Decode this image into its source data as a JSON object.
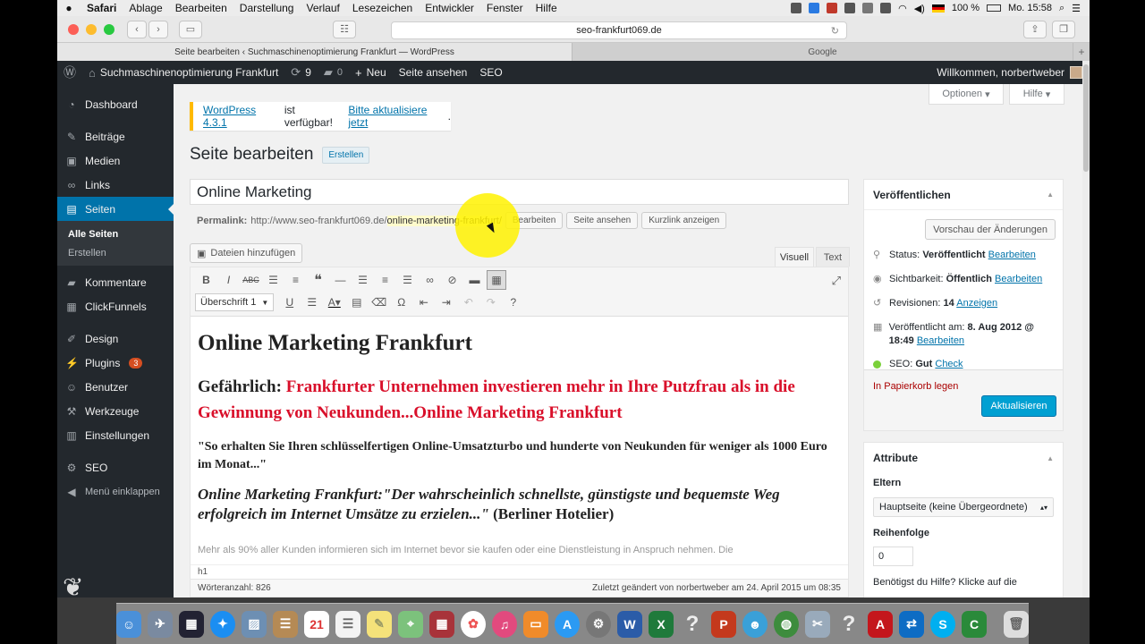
{
  "menubar": {
    "app": "Safari",
    "items": [
      "Ablage",
      "Bearbeiten",
      "Darstellung",
      "Verlauf",
      "Lesezeichen",
      "Entwickler",
      "Fenster",
      "Hilfe"
    ],
    "battery": "100 %",
    "clock": "Mo. 15:58"
  },
  "browser": {
    "url": "seo-frankfurt069.de",
    "tabs": [
      {
        "label": "Seite bearbeiten ‹ Suchmaschinenoptimierung Frankfurt — WordPress"
      },
      {
        "label": "Google"
      }
    ]
  },
  "adminbar": {
    "site": "Suchmaschinenoptimierung Frankfurt",
    "updates": "9",
    "comments": "0",
    "new": "Neu",
    "view": "Seite ansehen",
    "seo": "SEO",
    "welcome": "Willkommen, norbertweber"
  },
  "sidebar": {
    "items": [
      {
        "label": "Dashboard",
        "icon": "dashboard-icon"
      },
      {
        "label": "Beiträge",
        "icon": "pin-icon"
      },
      {
        "label": "Medien",
        "icon": "media-icon"
      },
      {
        "label": "Links",
        "icon": "link-icon"
      },
      {
        "label": "Seiten",
        "icon": "pages-icon"
      },
      {
        "label": "Kommentare",
        "icon": "comment-icon"
      },
      {
        "label": "ClickFunnels",
        "icon": "clickfunnels-icon"
      },
      {
        "label": "Design",
        "icon": "brush-icon"
      },
      {
        "label": "Plugins",
        "icon": "plugin-icon",
        "badge": "3"
      },
      {
        "label": "Benutzer",
        "icon": "users-icon"
      },
      {
        "label": "Werkzeuge",
        "icon": "wrench-icon"
      },
      {
        "label": "Einstellungen",
        "icon": "settings-icon"
      },
      {
        "label": "SEO",
        "icon": "seo-icon"
      },
      {
        "label": "Menü einklappen",
        "icon": "collapse-icon"
      }
    ],
    "sub": [
      "Alle Seiten",
      "Erstellen"
    ]
  },
  "screen_options": {
    "options": "Optionen",
    "help": "Hilfe"
  },
  "notice": {
    "link1": "WordPress 4.3.1",
    "text": "ist verfügbar!",
    "link2": "Bitte aktualisiere jetzt",
    "end": "."
  },
  "page": {
    "title": "Seite bearbeiten",
    "add_new": "Erstellen",
    "post_title": "Online Marketing",
    "permalink_label": "Permalink:",
    "permalink_base": "http://www.seo-frankfurt069.de/",
    "permalink_slug": "online-marketing-frankfurt/",
    "btn_edit": "Bearbeiten",
    "btn_view": "Seite ansehen",
    "btn_shortlink": "Kurzlink anzeigen",
    "media_btn": "Dateien hinzufügen",
    "tab_visual": "Visuell",
    "tab_text": "Text",
    "format_select": "Überschrift 1"
  },
  "content": {
    "h1": "Online Marketing Frankfurt",
    "h2_lead": "Gefährlich:",
    "h2_red": "Frankfurter Unternehmen investieren mehr in Ihre Putzfrau als in die Gewinnung von Neukunden...Online Marketing Frankfurt",
    "p1": "\"So erhalten Sie Ihren schlüsselfertigen Online-Umsatzturbo und hunderte von Neukunden für weniger als 1000 Euro im Monat...\"",
    "h3_italic": "Online Marketing Frankfurt:\"Der wahrscheinlich schnellste, günstigste und bequemste Weg erfolgreich im Internet Umsätze zu erzielen...\"",
    "h3_tail": "(Berliner Hotelier)",
    "fade_line": "Mehr als 90% aller Kunden informieren sich im Internet bevor sie kaufen oder eine Dienstleistung in Anspruch nehmen. Die",
    "path": "h1",
    "word_count": "Wörteranzahl: 826",
    "last_edit": "Zuletzt geändert von norbertweber am 24. April 2015 um 08:35"
  },
  "publish": {
    "title": "Veröffentlichen",
    "preview": "Vorschau der Änderungen",
    "status_label": "Status:",
    "status_value": "Veröffentlicht",
    "visibility_label": "Sichtbarkeit:",
    "visibility_value": "Öffentlich",
    "revisions_label": "Revisionen:",
    "revisions_value": "14",
    "revisions_link": "Anzeigen",
    "published_label": "Veröffentlicht am:",
    "published_value": "8. Aug 2012 @ 18:49",
    "edit": "Bearbeiten",
    "seo_label": "SEO:",
    "seo_value": "Gut",
    "seo_link": "Check",
    "trash": "In Papierkorb legen",
    "update": "Aktualisieren"
  },
  "attributes": {
    "title": "Attribute",
    "parent_label": "Eltern",
    "parent_value": "Hauptseite (keine Übergeordnete)",
    "order_label": "Reihenfolge",
    "order_value": "0",
    "help": "Benötigst du Hilfe? Klicke auf die"
  },
  "colors": {
    "wp_dark": "#23282d",
    "wp_blue": "#0073aa",
    "accent_red": "#d90f2a",
    "highlight": "#fff200"
  }
}
